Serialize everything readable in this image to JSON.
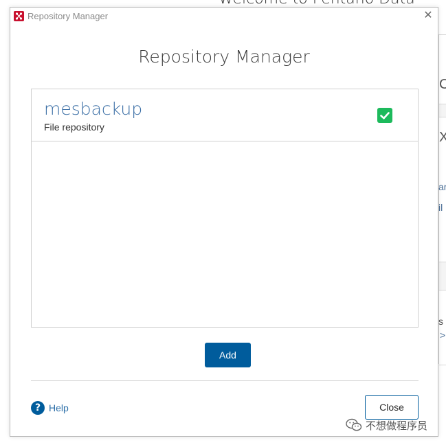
{
  "background": {
    "heading": "Welcome to Pentaho Data",
    "fragments": [
      "C",
      "X",
      "ar",
      "il",
      "s",
      ">"
    ]
  },
  "window": {
    "title": "Repository Manager",
    "close_symbol": "✕"
  },
  "dialog": {
    "heading": "Repository Manager",
    "repositories": [
      {
        "name": "mesbackup",
        "type": "File repository",
        "selected": true
      }
    ],
    "add_label": "Add",
    "help_icon": "?",
    "help_label": "Help",
    "close_label": "Close"
  },
  "watermark": {
    "text": "不想做程序员"
  },
  "colors": {
    "accent": "#005c9c",
    "repo_name": "#3a6ea5",
    "check": "#1dba5c",
    "app_icon": "#c8102e"
  }
}
